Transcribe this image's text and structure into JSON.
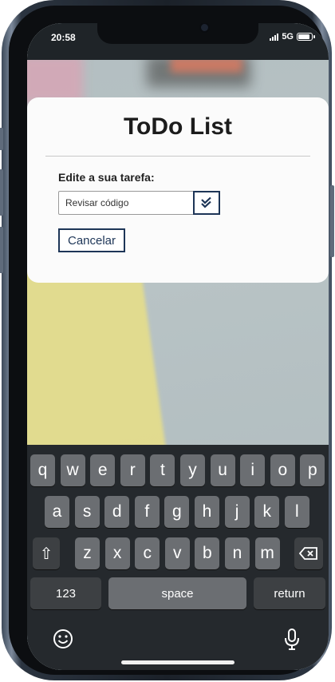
{
  "status": {
    "time": "20:58",
    "network": "5G"
  },
  "app": {
    "title": "ToDo List",
    "edit_label": "Edite a sua tarefa:",
    "task_value": "Revisar código",
    "cancel_label": "Cancelar",
    "confirm_icon": "double-check-icon"
  },
  "keyboard": {
    "row1": [
      "q",
      "w",
      "e",
      "r",
      "t",
      "y",
      "u",
      "i",
      "o",
      "p"
    ],
    "row2": [
      "a",
      "s",
      "d",
      "f",
      "g",
      "h",
      "j",
      "k",
      "l"
    ],
    "row3": [
      "z",
      "x",
      "c",
      "v",
      "b",
      "n",
      "m"
    ],
    "shift_symbol": "⇧",
    "numbers_label": "123",
    "space_label": "space",
    "return_label": "return"
  },
  "colors": {
    "accent": "#1d3557",
    "card": "#fbfbfb",
    "keyboard_bg": "#25292d",
    "key_bg": "#6b6e72"
  }
}
